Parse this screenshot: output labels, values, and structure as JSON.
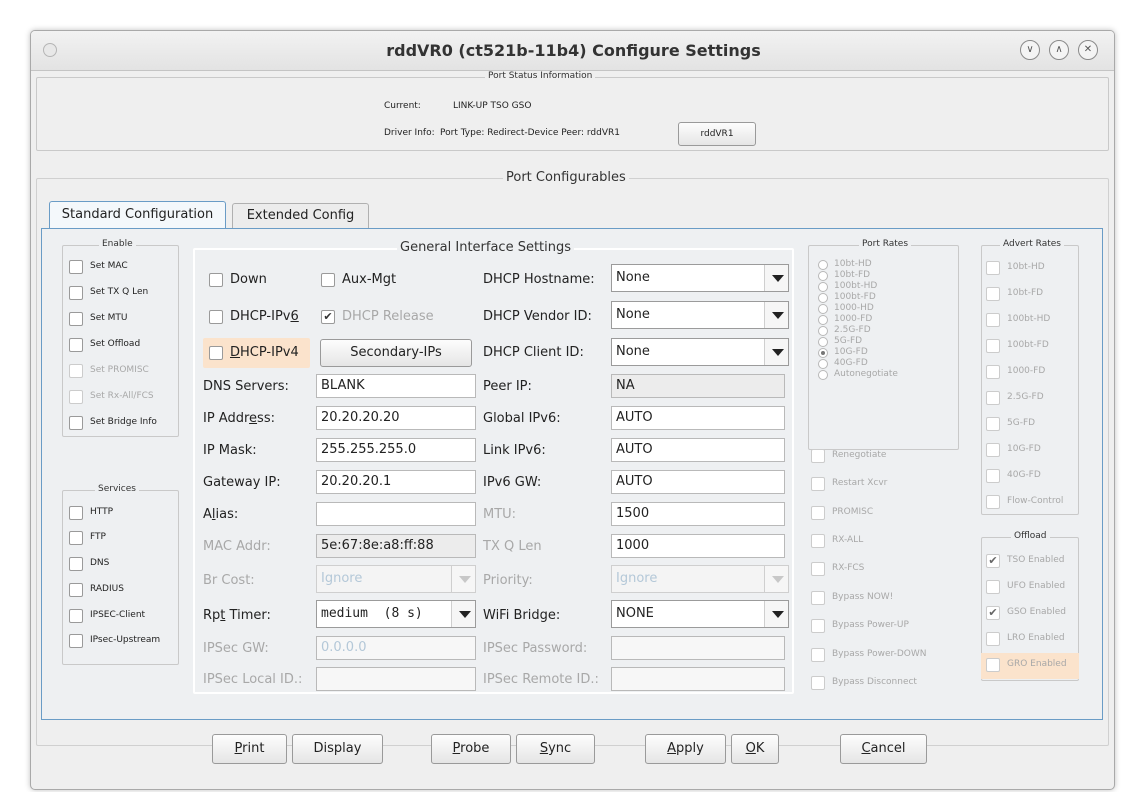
{
  "window": {
    "title": "rddVR0  (ct521b-11b4) Configure Settings"
  },
  "port_status": {
    "section_title": "Port Status Information",
    "current_label": "Current:",
    "current_value": "LINK-UP TSO GSO",
    "driver_label": "Driver Info:",
    "driver_value": "Port Type: Redirect-Device  Peer: rddVR1",
    "peer_button": "rddVR1"
  },
  "port_configurables": {
    "title": "Port Configurables"
  },
  "tabs": [
    {
      "label": "Standard Configuration",
      "active": true
    },
    {
      "label": "Extended Config",
      "active": false
    }
  ],
  "enable": {
    "title": "Enable",
    "items": [
      {
        "label": "Set MAC",
        "enabled": true,
        "checked": false
      },
      {
        "label": "Set TX Q Len",
        "enabled": true,
        "checked": false
      },
      {
        "label": "Set MTU",
        "enabled": true,
        "checked": false
      },
      {
        "label": "Set Offload",
        "enabled": true,
        "checked": false
      },
      {
        "label": "Set PROMISC",
        "enabled": false,
        "checked": false
      },
      {
        "label": "Set Rx-All/FCS",
        "enabled": false,
        "checked": false
      },
      {
        "label": "Set Bridge Info",
        "enabled": true,
        "checked": false
      }
    ]
  },
  "services": {
    "title": "Services",
    "items": [
      {
        "label": "HTTP"
      },
      {
        "label": "FTP"
      },
      {
        "label": "DNS"
      },
      {
        "label": "RADIUS"
      },
      {
        "label": "IPSEC-Client"
      },
      {
        "label": "IPsec-Upstream"
      }
    ]
  },
  "general": {
    "title": "General Interface Settings",
    "down": "Down",
    "aux_mgt": "Aux-Mgt",
    "dhcp_ipv6_pre": "DHCP-IPv",
    "dhcp_ipv6_u": "6",
    "dhcp_release": "DHCP Release",
    "dhcp_ipv4_u": "D",
    "dhcp_ipv4_rest": "HCP-IPv4",
    "secondary_ips": "Secondary-IPs",
    "dhcp_hostname_label": "DHCP Hostname:",
    "dhcp_hostname_value": "None",
    "dhcp_vendor_label": "DHCP Vendor ID:",
    "dhcp_vendor_value": "None",
    "dhcp_client_label": "DHCP Client ID:",
    "dhcp_client_value": "None",
    "dns_label": "DNS Servers:",
    "dns_value": "BLANK",
    "peer_ip_label": "Peer IP:",
    "peer_ip_value": "NA",
    "ip_addr_pre": "IP Addr",
    "ip_addr_u": "e",
    "ip_addr_post": "ss:",
    "ip_addr_value": "20.20.20.20",
    "global_ipv6_label": "Global IPv6:",
    "global_ipv6_value": "AUTO",
    "ip_mask_label": "IP Mask:",
    "ip_mask_value": "255.255.255.0",
    "link_ipv6_label": "Link IPv6:",
    "link_ipv6_value": "AUTO",
    "gateway_label": "Gateway IP:",
    "gateway_value": "20.20.20.1",
    "ipv6_gw_label": "IPv6 GW:",
    "ipv6_gw_value": "AUTO",
    "alias_pre": "A",
    "alias_u": "l",
    "alias_post": "ias:",
    "alias_value": "",
    "mtu_label": "MTU:",
    "mtu_value": "1500",
    "mac_label": "MAC Addr:",
    "mac_value": "5e:67:8e:a8:ff:88",
    "txq_label": "TX Q Len",
    "txq_value": "1000",
    "br_cost_label": "Br Cost:",
    "br_cost_value": "Ignore",
    "priority_label": "Priority:",
    "priority_value": "Ignore",
    "rpt_pre": "Rp",
    "rpt_u": "t",
    "rpt_post": " Timer:",
    "rpt_value": "medium  (8 s)",
    "wifi_bridge_label": "WiFi Bridge:",
    "wifi_bridge_value": "NONE",
    "ipsec_gw_label": "IPSec GW:",
    "ipsec_gw_value": "0.0.0.0",
    "ipsec_pw_label": "IPSec Password:",
    "ipsec_pw_value": "",
    "ipsec_local_label": "IPSec Local ID.:",
    "ipsec_local_value": "",
    "ipsec_remote_label": "IPSec Remote ID.:",
    "ipsec_remote_value": ""
  },
  "port_rates": {
    "title": "Port Rates",
    "options": [
      "10bt-HD",
      "10bt-FD",
      "100bt-HD",
      "100bt-FD",
      "1000-HD",
      "1000-FD",
      "2.5G-FD",
      "5G-FD",
      "10G-FD",
      "40G-FD",
      "Autonegotiate"
    ],
    "selected": "10G-FD"
  },
  "port_actions": [
    "Renegotiate",
    "Restart Xcvr",
    "PROMISC",
    "RX-ALL",
    "RX-FCS",
    "Bypass NOW!",
    "Bypass Power-UP",
    "Bypass Power-DOWN",
    "Bypass Disconnect"
  ],
  "advert_rates": {
    "title": "Advert Rates",
    "items": [
      "10bt-HD",
      "10bt-FD",
      "100bt-HD",
      "100bt-FD",
      "1000-FD",
      "2.5G-FD",
      "5G-FD",
      "10G-FD",
      "40G-FD",
      "Flow-Control"
    ]
  },
  "offload": {
    "title": "Offload",
    "items": [
      {
        "label": "TSO Enabled",
        "checked": true
      },
      {
        "label": "UFO Enabled",
        "checked": false
      },
      {
        "label": "GSO Enabled",
        "checked": true
      },
      {
        "label": "LRO Enabled",
        "checked": false
      },
      {
        "label": "GRO Enabled",
        "checked": false
      }
    ]
  },
  "footer": {
    "print_u": "P",
    "print_rest": "rint",
    "display": "Display",
    "probe_u": "P",
    "probe_rest": "robe",
    "sync_u": "S",
    "sync_rest": "ync",
    "apply_u": "A",
    "apply_rest": "pply",
    "ok_u": "O",
    "ok_rest": "K",
    "cancel_u": "C",
    "cancel_rest": "ancel"
  },
  "colors": {
    "focus_highlight": "#fbe3cc",
    "tab_border": "#6a9cc6"
  }
}
